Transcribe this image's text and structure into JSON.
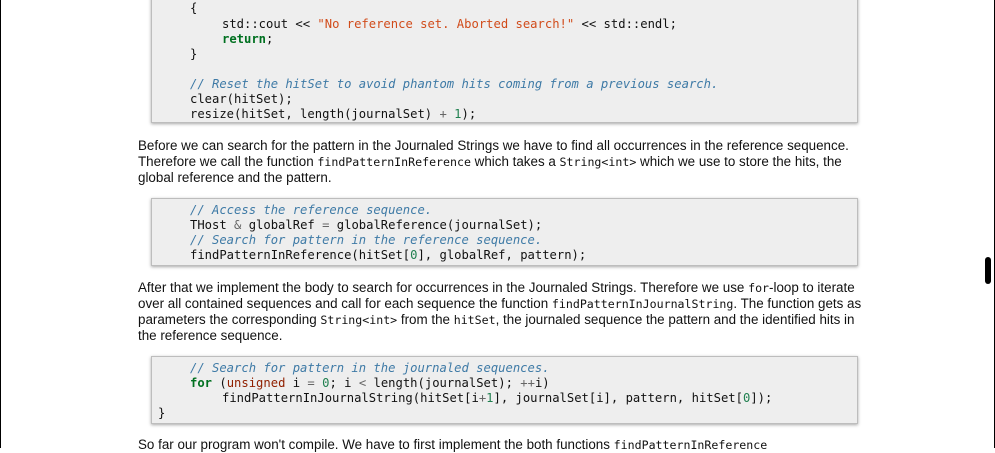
{
  "code1": {
    "l1": "{",
    "l2a": "std::cout << ",
    "l2s": "\"No reference set. Aborted search!\"",
    "l2b": " << std::endl;",
    "l3": "return",
    "l3b": ";",
    "l4": "}",
    "l5": "// Reset the hitSet to avoid phantom hits coming from a previous search.",
    "l6": "clear(hitSet);",
    "l7a": "resize(hitSet, length(journalSet) ",
    "l7op": "+",
    "l7n": " 1",
    "l7b": ");"
  },
  "para1": {
    "t1": "Before we can search for the pattern in the Journaled Strings we have to find all occurrences in the reference sequence. Therefore we call the function ",
    "c1": "findPatternInReference",
    "t2": " which takes a ",
    "c2": "String<int>",
    "t3": " which we use to store the hits, the global reference and the pattern."
  },
  "code2": {
    "l1": "// Access the reference sequence.",
    "l2a": "THost ",
    "l2op": "&",
    "l2b": " globalRef ",
    "l2eq": "=",
    "l2c": " globalReference(journalSet);",
    "l3": "// Search for pattern in the reference sequence.",
    "l4a": "findPatternInReference(hitSet[",
    "l4n": "0",
    "l4b": "], globalRef, pattern);"
  },
  "para2": {
    "t1": "After that we implement the body to search for occurrences in the Journaled Strings. Therefore we use ",
    "c1": "for",
    "t2": "-loop to iterate over all contained sequences and call for each sequence the function ",
    "c2": "findPatternInJournalString",
    "t3": ". The function gets as parameters the corresponding ",
    "c3": "String<int>",
    "t4": " from the ",
    "c4": "hitSet",
    "t5": ", the journaled sequence the pattern and the identified hits in the reference sequence."
  },
  "code3": {
    "l1": "// Search for pattern in the journaled sequences.",
    "l2kw": "for",
    "l2a": " (",
    "l2typ": "unsigned",
    "l2b": " i ",
    "l2eq": "=",
    "l2n": " 0",
    "l2c": "; i ",
    "l2lt": "<",
    "l2d": " length(journalSet); ",
    "l2inc": "++",
    "l2e": "i)",
    "l3a": "findPatternInJournalString(hitSet[i",
    "l3op": "+",
    "l3n": "1",
    "l3b": "], journalSet[i], pattern, hitSet[",
    "l3n2": "0",
    "l3c": "]);",
    "l4": "}"
  },
  "para3": {
    "t1": "So far our program won't compile. We have to first implement the both functions ",
    "c1": "findPatternInReference"
  }
}
